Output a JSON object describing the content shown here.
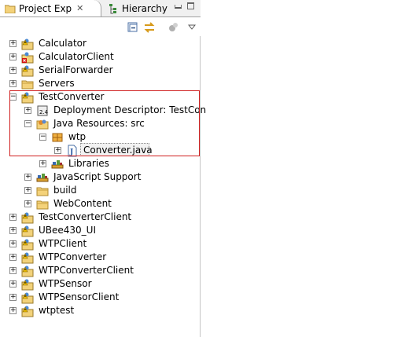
{
  "tabs": {
    "active_label": "Project Exp",
    "inactive_label": "Hierarchy",
    "close_glyph": "✕"
  },
  "toolbar": {
    "icons": [
      "collapse-all-icon",
      "link-with-editor-icon",
      "filters-icon",
      "view-menu-icon"
    ]
  },
  "tree": [
    {
      "label": "Calculator",
      "icon": "project-warning-icon",
      "expander": "+"
    },
    {
      "label": "CalculatorClient",
      "icon": "project-error-icon",
      "expander": "+"
    },
    {
      "label": "SerialForwarder",
      "icon": "project-warning-icon",
      "expander": "+"
    },
    {
      "label": "Servers",
      "icon": "folder-icon",
      "expander": "+"
    },
    {
      "label": "TestConverter",
      "icon": "project-warning-icon",
      "expander": "−"
    },
    {
      "label": "Deployment Descriptor: TestCon",
      "icon": "deployment-descriptor-icon",
      "expander": "+"
    },
    {
      "label": "Java Resources: src",
      "icon": "java-resources-icon",
      "expander": "−"
    },
    {
      "label": "wtp",
      "icon": "package-icon",
      "expander": "−"
    },
    {
      "label": "Converter.java",
      "icon": "java-file-icon",
      "expander": "+"
    },
    {
      "label": "Libraries",
      "icon": "libraries-icon",
      "expander": "+"
    },
    {
      "label": "JavaScript Support",
      "icon": "libraries-icon",
      "expander": "+"
    },
    {
      "label": "build",
      "icon": "folder-icon",
      "expander": "+"
    },
    {
      "label": "WebContent",
      "icon": "folder-icon",
      "expander": "+"
    },
    {
      "label": "TestConverterClient",
      "icon": "project-warning-icon",
      "expander": "+"
    },
    {
      "label": "UBee430_UI",
      "icon": "project-warning-icon",
      "expander": "+"
    },
    {
      "label": "WTPClient",
      "icon": "project-warning-icon",
      "expander": "+"
    },
    {
      "label": "WTPConverter",
      "icon": "project-warning-icon",
      "expander": "+"
    },
    {
      "label": "WTPConverterClient",
      "icon": "project-warning-icon",
      "expander": "+"
    },
    {
      "label": "WTPSensor",
      "icon": "project-warning-icon",
      "expander": "+"
    },
    {
      "label": "WTPSensorClient",
      "icon": "project-warning-icon",
      "expander": "+"
    },
    {
      "label": "wtptest",
      "icon": "project-warning-icon",
      "expander": "+"
    }
  ],
  "selected_label": "Converter.java",
  "colors": {
    "highlight_box": "#d02020",
    "warning": "#f0c000",
    "error": "#d01010"
  }
}
